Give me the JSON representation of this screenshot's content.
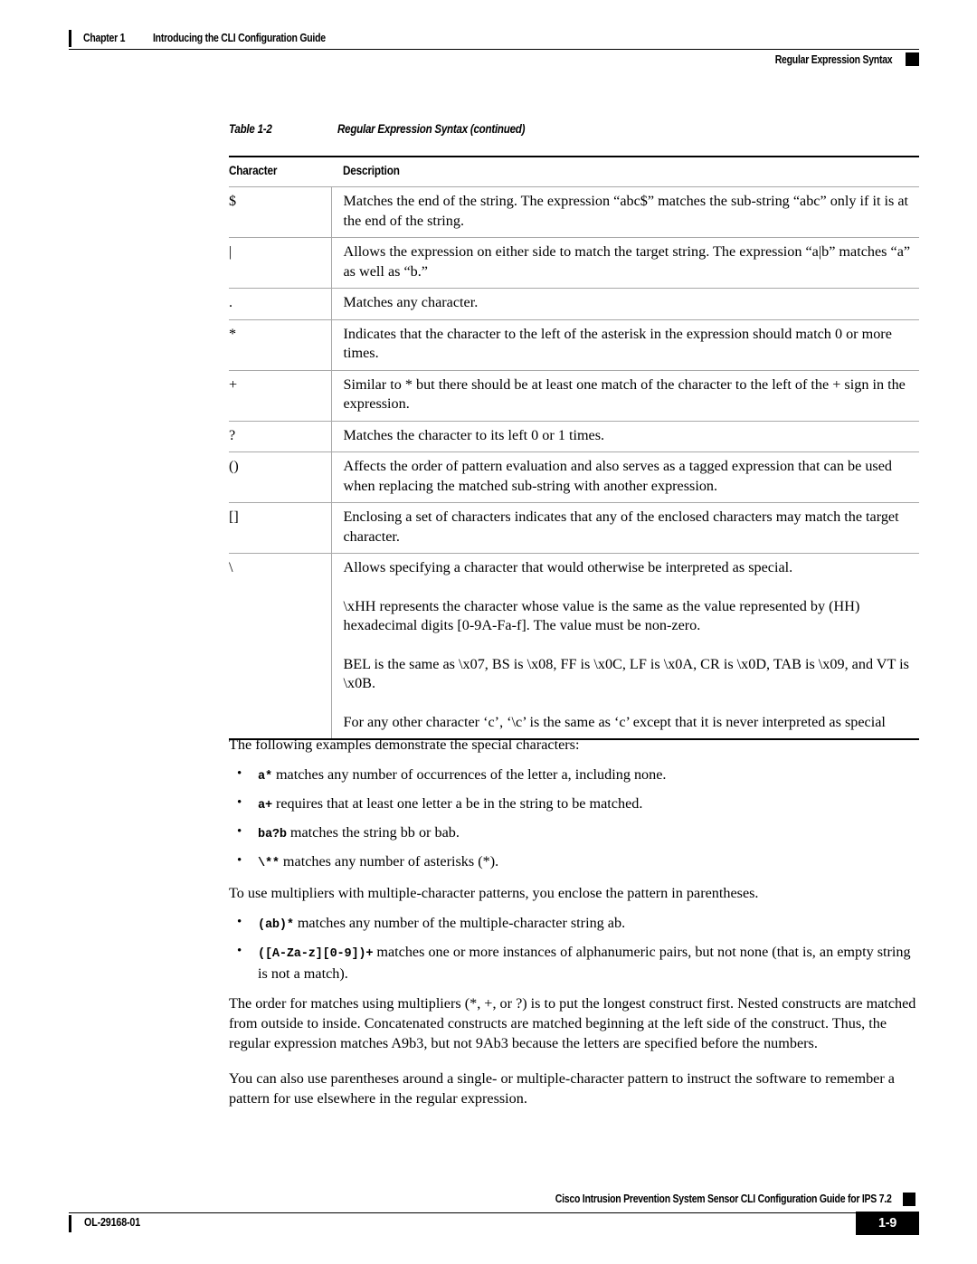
{
  "header": {
    "chapter_label": "Chapter 1",
    "chapter_title": "Introducing the CLI Configuration Guide",
    "section_title": "Regular Expression Syntax"
  },
  "table": {
    "caption_number": "Table 1-2",
    "caption_title": "Regular Expression Syntax (continued)",
    "columns": [
      "Character",
      "Description"
    ],
    "rows": [
      {
        "character": "$",
        "description": "Matches the end of the string. The expression “abc$” matches the sub-string “abc” only if it is at the end of the string."
      },
      {
        "character": "|",
        "description": "Allows the expression on either side to match the target string. The expression “a|b” matches “a” as well as “b.”"
      },
      {
        "character": ".",
        "description": "Matches any character."
      },
      {
        "character": "*",
        "description": "Indicates that the character to the left of the asterisk in the expression should match 0 or more times."
      },
      {
        "character": "+",
        "description": "Similar to * but there should be at least one match of the character to the left of the + sign in the expression."
      },
      {
        "character": "?",
        "description": "Matches the character to its left 0 or 1 times."
      },
      {
        "character": "()",
        "description": "Affects the order of pattern evaluation and also serves as a tagged expression that can be used when replacing the matched sub-string with another expression."
      },
      {
        "character": "[]",
        "description": "Enclosing a set of characters indicates that any of the enclosed characters may match the target character."
      },
      {
        "character": "\\",
        "description_paragraphs": [
          "Allows specifying a character that would otherwise be interpreted as special.",
          "\\xHH represents the character whose value is the same as the value represented by (HH) hexadecimal digits [0-9A-Fa-f]. The value must be non-zero.",
          "BEL is the same as \\x07, BS is \\x08, FF is \\x0C, LF is \\x0A, CR is \\x0D, TAB is \\x09, and VT is \\x0B.",
          "For any other character ‘c’, ‘\\c’ is the same as ‘c’ except that it is never interpreted as special"
        ]
      }
    ]
  },
  "body": {
    "intro_examples": "The following examples demonstrate the special characters:",
    "examples": [
      {
        "code": "a*",
        "text": "matches any number of occurrences of the letter a, including none."
      },
      {
        "code": "a+",
        "text": "requires that at least one letter a be in the string to be matched."
      },
      {
        "code": "ba?b",
        "text": "matches the string bb or bab."
      },
      {
        "code": "\\**",
        "text": "matches any number of asterisks (*)."
      }
    ],
    "intro_multipliers": "To use multipliers with multiple-character patterns, you enclose the pattern in parentheses.",
    "multiplier_examples": [
      {
        "code": "(ab)*",
        "text": "matches any number of the multiple-character string ab."
      },
      {
        "code": "([A-Za-z][0-9])+",
        "text": "matches one or more instances of alphanumeric pairs, but not none (that is, an empty string is not a match)."
      }
    ],
    "paragraph_order": "The order for matches using multipliers (*, +, or ?) is to put the longest construct first. Nested constructs are matched from outside to inside. Concatenated constructs are matched beginning at the left side of the construct. Thus, the regular expression matches A9b3, but not 9Ab3 because the letters are specified before the numbers.",
    "paragraph_parentheses": "You can also use parentheses around a single- or multiple-character pattern to instruct the software to remember a pattern for use elsewhere in the regular expression."
  },
  "footer": {
    "guide_title": "Cisco Intrusion Prevention System Sensor CLI Configuration Guide for IPS 7.2",
    "doc_id": "OL-29168-01",
    "page_number": "1-9"
  }
}
